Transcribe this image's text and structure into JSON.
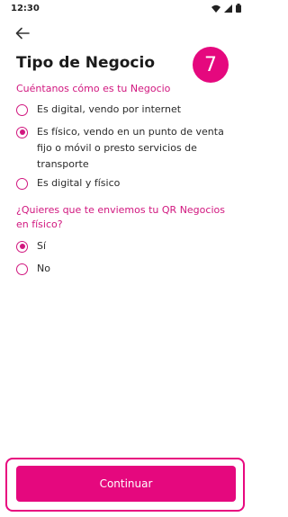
{
  "status_bar": {
    "time": "12:30",
    "icons": [
      "wifi-icon",
      "signal-icon",
      "battery-icon"
    ]
  },
  "header": {
    "back_icon": "arrow-left-icon",
    "title": "Tipo de Negocio",
    "step_number": "7"
  },
  "question1": {
    "title": "Cuéntanos cómo es tu Negocio",
    "options": [
      {
        "label": "Es digital, vendo por internet",
        "selected": false
      },
      {
        "label": "Es físico, vendo en un punto de venta fijo o móvil o presto servicios de transporte",
        "selected": true
      },
      {
        "label": "Es digital y físico",
        "selected": false
      }
    ]
  },
  "question2": {
    "title": "¿Quieres que te enviemos tu QR Negocios en físico?",
    "options": [
      {
        "label": "Sí",
        "selected": true
      },
      {
        "label": "No",
        "selected": false
      }
    ]
  },
  "footer": {
    "continue_label": "Continuar"
  },
  "colors": {
    "accent": "#e5087e",
    "accent_text": "#d1177f"
  }
}
